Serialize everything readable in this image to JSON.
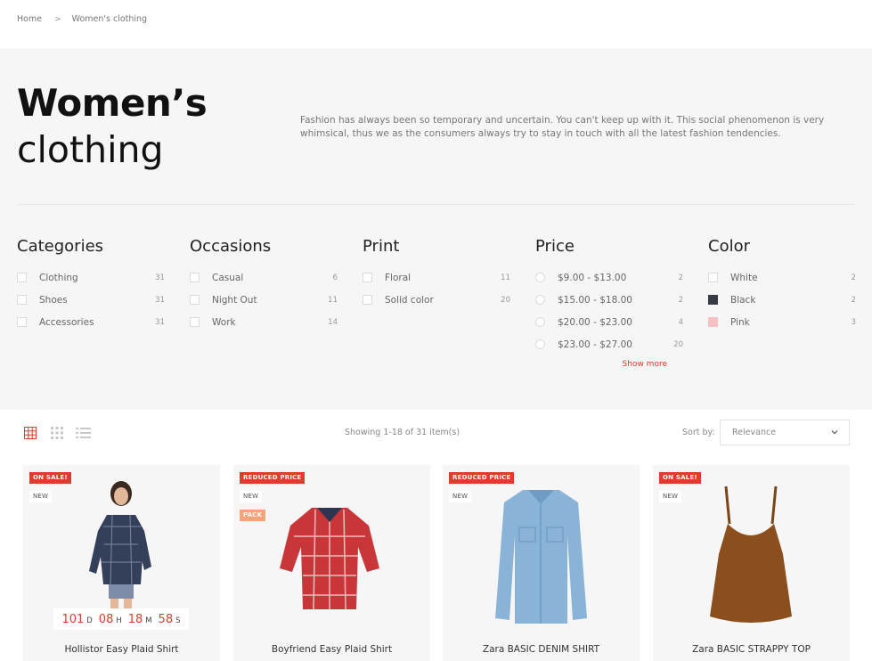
{
  "breadcrumb": {
    "home": "Home",
    "separator": ">",
    "current": "Women's clothing"
  },
  "hero": {
    "title_bold": "Women’s",
    "title_light": "clothing",
    "description": "Fashion has always been so temporary and uncertain. You can't keep up with it.  This social phenomenon is very whimsical, thus we as the consumers always try to stay in touch with all the latest fashion tendencies."
  },
  "facets": {
    "categories": {
      "title": "Categories",
      "items": [
        {
          "label": "Clothing",
          "count": "31"
        },
        {
          "label": "Shoes",
          "count": "31"
        },
        {
          "label": "Accessories",
          "count": "31"
        }
      ]
    },
    "occasions": {
      "title": "Occasions",
      "items": [
        {
          "label": "Casual",
          "count": "6"
        },
        {
          "label": "Night Out",
          "count": "11"
        },
        {
          "label": "Work",
          "count": "14"
        }
      ]
    },
    "print": {
      "title": "Print",
      "items": [
        {
          "label": "Floral",
          "count": "11"
        },
        {
          "label": "Solid color",
          "count": "20"
        }
      ]
    },
    "price": {
      "title": "Price",
      "items": [
        {
          "label": "$9.00 - $13.00",
          "count": "2"
        },
        {
          "label": "$15.00 - $18.00",
          "count": "2"
        },
        {
          "label": "$20.00 - $23.00",
          "count": "4"
        },
        {
          "label": "$23.00 - $27.00",
          "count": "20"
        }
      ],
      "show_more": "Show more"
    },
    "color": {
      "title": "Color",
      "items": [
        {
          "label": "White",
          "count": "2",
          "swatch": "#ffffff"
        },
        {
          "label": "Black",
          "count": "2",
          "swatch": "#363b45"
        },
        {
          "label": "Pink",
          "count": "3",
          "swatch": "#f5c2c4"
        }
      ]
    }
  },
  "toolbar": {
    "showing": "Showing 1-18 of 31 item(s)",
    "sort_label": "Sort by:",
    "sort_value": "Relevance",
    "view_icons": [
      "grid-large-icon",
      "grid-small-icon",
      "list-view-icon"
    ]
  },
  "products": [
    {
      "name": "Hollistor Easy Plaid Shirt",
      "flag1": "ON SALE!",
      "flag2": "NEW",
      "countdown": {
        "days": "101",
        "days_u": "D",
        "hours": "08",
        "hours_u": "H",
        "minutes": "18",
        "minutes_u": "M",
        "seconds": "58",
        "seconds_u": "S"
      }
    },
    {
      "name": "Boyfriend Easy Plaid Shirt",
      "flag1": "REDUCED PRICE",
      "flag2": "NEW",
      "flag3": "PACK"
    },
    {
      "name": "Zara BASIC DENIM SHIRT",
      "flag1": "REDUCED PRICE",
      "flag2": "NEW"
    },
    {
      "name": "Zara BASIC STRAPPY TOP",
      "flag1": "ON SALE!",
      "flag2": "NEW"
    }
  ],
  "colors": {
    "accent": "#e03c2d",
    "pack": "#f5a37a",
    "panel": "#f6f6f6"
  }
}
